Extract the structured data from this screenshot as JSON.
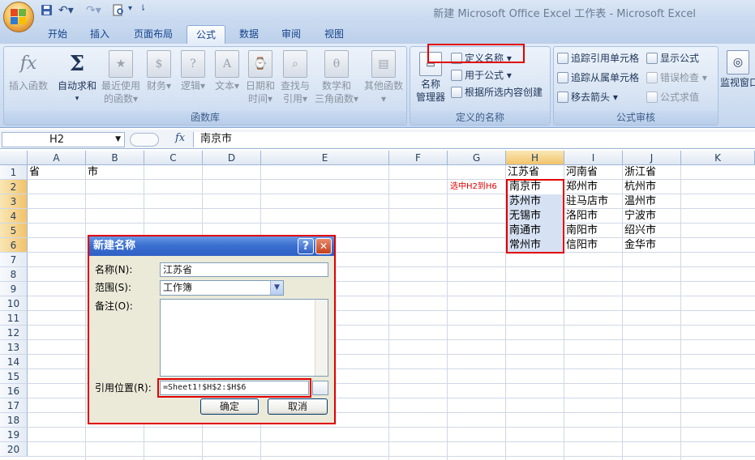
{
  "window": {
    "title": "新建 Microsoft Office Excel 工作表 - Microsoft Excel"
  },
  "tabs": [
    "开始",
    "插入",
    "页面布局",
    "公式",
    "数据",
    "审阅",
    "视图"
  ],
  "active_tab": "公式",
  "ribbon": {
    "function_library": {
      "label": "函数库",
      "buttons": [
        {
          "icon": "fx-icon",
          "l1": "插入函数",
          "l2": ""
        },
        {
          "icon": "sigma-icon",
          "l1": "自动求和",
          "l2": ""
        },
        {
          "icon": "book-star-icon",
          "l1": "最近使用",
          "l2": "的函数"
        },
        {
          "icon": "book-finance-icon",
          "l1": "财务",
          "l2": ""
        },
        {
          "icon": "book-logic-icon",
          "l1": "逻辑",
          "l2": ""
        },
        {
          "icon": "book-text-icon",
          "l1": "文本",
          "l2": ""
        },
        {
          "icon": "book-date-icon",
          "l1": "日期和",
          "l2": "时间"
        },
        {
          "icon": "book-lookup-icon",
          "l1": "查找与",
          "l2": "引用"
        },
        {
          "icon": "book-math-icon",
          "l1": "数学和",
          "l2": "三角函数"
        },
        {
          "icon": "book-more-icon",
          "l1": "其他函数",
          "l2": ""
        }
      ]
    },
    "defined_names": {
      "label": "定义的名称",
      "manager": {
        "l1": "名称",
        "l2": "管理器"
      },
      "define_name": "定义名称",
      "use_in_formula": "用于公式",
      "create_from_selection": "根据所选内容创建"
    },
    "formula_auditing": {
      "label": "公式审核",
      "trace_precedents": "追踪引用单元格",
      "trace_dependents": "追踪从属单元格",
      "remove_arrows": "移去箭头",
      "show_formulas": "显示公式",
      "error_checking": "错误检查",
      "evaluate_formula": "公式求值"
    },
    "watch_window": "监视窗口"
  },
  "formula_bar": {
    "name_box": "H2",
    "fx": "fx",
    "value": "南京市"
  },
  "grid": {
    "columns": [
      "A",
      "B",
      "C",
      "D",
      "E",
      "F",
      "G",
      "H",
      "I",
      "J",
      "K"
    ],
    "rows": [
      "1",
      "2",
      "3",
      "4",
      "5",
      "6",
      "7",
      "8",
      "9",
      "10",
      "11",
      "12",
      "13",
      "14",
      "15",
      "16",
      "17",
      "18",
      "19",
      "20"
    ],
    "cells": {
      "A1": "省",
      "B1": "市",
      "H1": "江苏省",
      "I1": "河南省",
      "J1": "浙江省",
      "H2": "南京市",
      "I2": "郑州市",
      "J2": "杭州市",
      "H3": "苏州市",
      "I3": "驻马店市",
      "J3": "温州市",
      "H4": "无锡市",
      "I4": "洛阳市",
      "J4": "宁波市",
      "H5": "南通市",
      "I5": "南阳市",
      "J5": "绍兴市",
      "H6": "常州市",
      "I6": "信阳市",
      "J6": "金华市"
    },
    "annotation": "选中H2到H6"
  },
  "dialog": {
    "title": "新建名称",
    "name_label": "名称(N):",
    "name_value": "江苏省",
    "scope_label": "范围(S):",
    "scope_value": "工作簿",
    "comment_label": "备注(O):",
    "refers_label": "引用位置(R):",
    "refers_value": "=Sheet1!$H$2:$H$6",
    "ok": "确定",
    "cancel": "取消",
    "help": "?",
    "close": "✕"
  }
}
